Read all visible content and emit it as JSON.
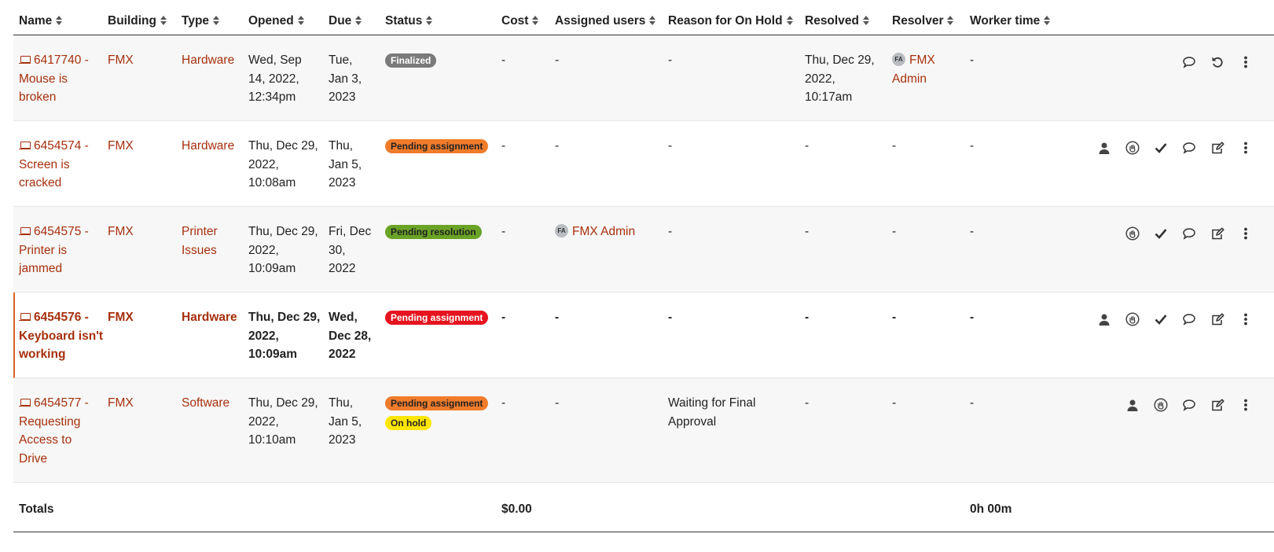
{
  "columns": {
    "name": "Name",
    "building": "Building",
    "type": "Type",
    "opened": "Opened",
    "due": "Due",
    "status": "Status",
    "cost": "Cost",
    "assigned": "Assigned users",
    "reason": "Reason for On Hold",
    "resolved": "Resolved",
    "resolver": "Resolver",
    "worker_time": "Worker time"
  },
  "rows": [
    {
      "name_id": "6417740 -",
      "name_l2": "Mouse is",
      "name_l3": "broken",
      "name_l4": "",
      "building": "FMX",
      "type_l1": "Hardware",
      "type_l2": "",
      "opened_l1": "Wed, Sep",
      "opened_l2": "14, 2022,",
      "opened_l3": "12:34pm",
      "due_l1": "Tue,",
      "due_l2": "Jan 3,",
      "due_l3": "2023",
      "status1": "Finalized",
      "status2": "",
      "cost": "-",
      "assigned": "-",
      "reason_l1": "-",
      "reason_l2": "",
      "resolved_l1": "Thu, Dec 29,",
      "resolved_l2": "2022,",
      "resolved_l3": "10:17am",
      "resolver_initials": "FA",
      "resolver_l1": "FMX",
      "resolver_l2": "Admin",
      "worker_time": "-"
    },
    {
      "name_id": "6454574 -",
      "name_l2": "Screen is",
      "name_l3": "cracked",
      "name_l4": "",
      "building": "FMX",
      "type_l1": "Hardware",
      "type_l2": "",
      "opened_l1": "Thu, Dec 29,",
      "opened_l2": "2022,",
      "opened_l3": "10:08am",
      "due_l1": "Thu,",
      "due_l2": "Jan 5,",
      "due_l3": "2023",
      "status1": "Pending assignment",
      "status2": "",
      "cost": "-",
      "assigned": "-",
      "reason_l1": "-",
      "reason_l2": "",
      "resolved_l1": "-",
      "resolved_l2": "",
      "resolved_l3": "",
      "resolver_l1": "-",
      "resolver_l2": "",
      "worker_time": "-"
    },
    {
      "name_id": "6454575 -",
      "name_l2": "Printer is",
      "name_l3": "jammed",
      "name_l4": "",
      "building": "FMX",
      "type_l1": "Printer",
      "type_l2": "Issues",
      "opened_l1": "Thu, Dec 29,",
      "opened_l2": "2022,",
      "opened_l3": "10:09am",
      "due_l1": "Fri, Dec",
      "due_l2": "30,",
      "due_l3": "2022",
      "status1": "Pending resolution",
      "status2": "",
      "cost": "-",
      "assigned_initials": "FA",
      "assigned": "FMX Admin",
      "reason_l1": "-",
      "reason_l2": "",
      "resolved_l1": "-",
      "resolved_l2": "",
      "resolved_l3": "",
      "resolver_l1": "-",
      "resolver_l2": "",
      "worker_time": "-"
    },
    {
      "name_id": "6454576 -",
      "name_l2": "Keyboard isn't",
      "name_l3": "working",
      "name_l4": "",
      "building": "FMX",
      "type_l1": "Hardware",
      "type_l2": "",
      "opened_l1": "Thu, Dec 29,",
      "opened_l2": "2022,",
      "opened_l3": "10:09am",
      "due_l1": "Wed,",
      "due_l2": "Dec 28,",
      "due_l3": "2022",
      "status1": "Pending assignment",
      "status2": "",
      "cost": "-",
      "assigned": "-",
      "reason_l1": "-",
      "reason_l2": "",
      "resolved_l1": "-",
      "resolved_l2": "",
      "resolved_l3": "",
      "resolver_l1": "-",
      "resolver_l2": "",
      "worker_time": "-"
    },
    {
      "name_id": "6454577 -",
      "name_l2": "Requesting",
      "name_l3": "Access to",
      "name_l4": "Drive",
      "building": "FMX",
      "type_l1": "Software",
      "type_l2": "",
      "opened_l1": "Thu, Dec 29,",
      "opened_l2": "2022,",
      "opened_l3": "10:10am",
      "due_l1": "Thu,",
      "due_l2": "Jan 5,",
      "due_l3": "2023",
      "status1": "Pending assignment",
      "status2": "On hold",
      "cost": "-",
      "assigned": "-",
      "reason_l1": "Waiting for Final",
      "reason_l2": "Approval",
      "resolved_l1": "-",
      "resolved_l2": "",
      "resolved_l3": "",
      "resolver_l1": "-",
      "resolver_l2": "",
      "worker_time": "-"
    }
  ],
  "totals": {
    "label": "Totals",
    "cost": "$0.00",
    "worker_time": "0h 00m"
  },
  "colors": {
    "link": "#a6300d",
    "finalized": "#7a7a7a",
    "pending_assignment": "#f07c2b",
    "pending_resolution": "#6aa325",
    "overdue": "#e5141f",
    "on_hold": "#ffe600"
  },
  "icons": {
    "assign": "user-icon",
    "hand": "hand-icon",
    "resolve": "check-icon",
    "comment": "comment-icon",
    "edit": "edit-icon",
    "more": "more-icon",
    "reopen": "reopen-icon"
  }
}
